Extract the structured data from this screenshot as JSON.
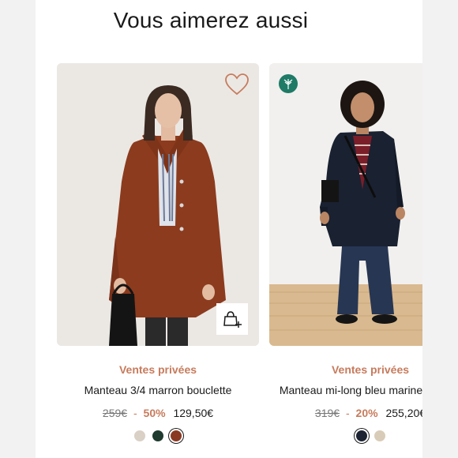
{
  "section": {
    "title": "Vous aimerez aussi"
  },
  "products": [
    {
      "tag": "Ventes privées",
      "name": "Manteau 3/4 marron bouclette",
      "old_price": "259€",
      "separator": "-",
      "discount": "50%",
      "price": "129,50€",
      "swatches": [
        "#d9d0c6",
        "#1f3a2e",
        "#8a3a22"
      ],
      "selected_swatch": 2,
      "icons": [
        "heart-icon",
        "add-to-bag-icon"
      ]
    },
    {
      "tag": "Ventes privées",
      "name": "Manteau mi-long bleu marine lainage",
      "old_price": "319€",
      "separator": "-",
      "discount": "20%",
      "price": "255,20€",
      "swatches": [
        "#1c2433",
        "#d8ccb8"
      ],
      "selected_swatch": 0,
      "icons": [
        "eco-leaf-icon"
      ]
    }
  ],
  "colors": {
    "accent": "#c77b5c",
    "eco_badge": "#1f7a66"
  }
}
